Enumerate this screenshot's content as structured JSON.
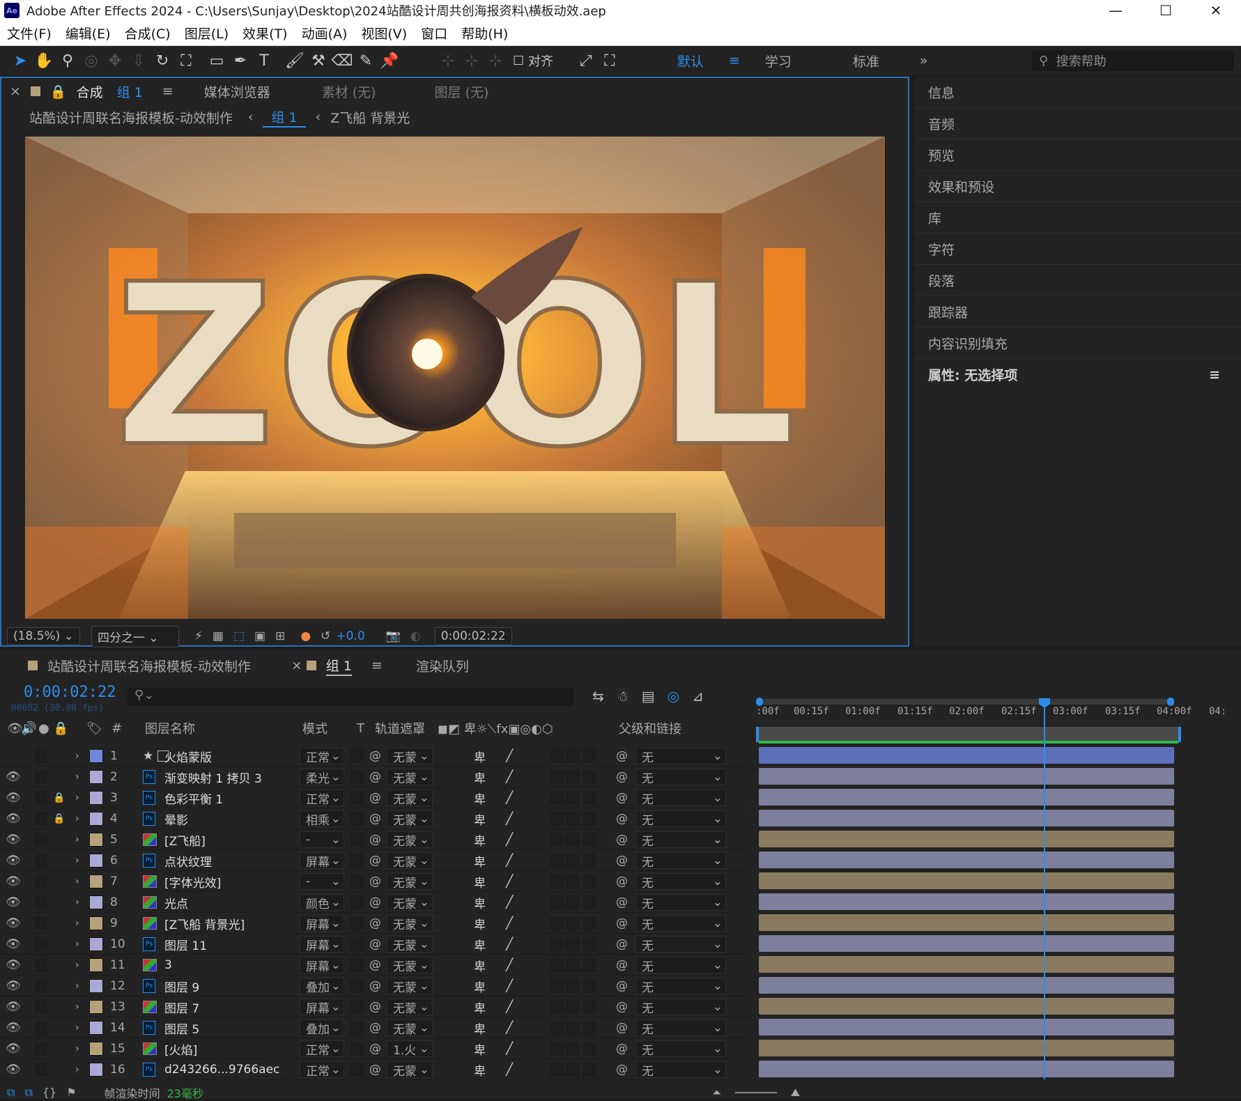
{
  "window": {
    "title": "Adobe After Effects 2024 - C:\\Users\\Sunjay\\Desktop\\2024站酷设计周共创海报资料\\横板动效.aep",
    "logo": "Ae",
    "controls": [
      "—",
      "☐",
      "✕"
    ]
  },
  "menu": [
    "文件(F)",
    "编辑(E)",
    "合成(C)",
    "图层(L)",
    "效果(T)",
    "动画(A)",
    "视图(V)",
    "窗口",
    "帮助(H)"
  ],
  "toolbar": {
    "snap_label": "对齐",
    "workspaces": [
      "默认",
      "学习",
      "标准"
    ],
    "active_workspace": "默认",
    "search_placeholder": "搜索帮助"
  },
  "comp_panel": {
    "tabs": {
      "close": "×",
      "comp_prefix": "合成",
      "comp_name": "组 1",
      "media": "媒体浏览器",
      "footage": "素材  (无)",
      "layer": "图层  (无)"
    },
    "breadcrumbs": [
      "站酷设计周联名海报模板-动效制作",
      "组 1",
      "Z飞船 背景光"
    ],
    "viewer_text": "ZOOL",
    "zoom": "(18.5%)",
    "resolution": "四分之一",
    "exposure": "+0.0",
    "timecode": "0:00:02:22"
  },
  "right_panel": {
    "items": [
      "信息",
      "音频",
      "预览",
      "效果和预设",
      "库",
      "字符",
      "段落",
      "跟踪器",
      "内容识别填充"
    ],
    "properties": "属性: 无选择项"
  },
  "timeline": {
    "tabs": [
      "站酷设计周联名海报模板-动效制作",
      "组 1",
      "渲染队列"
    ],
    "timecode": "0:00:02:22",
    "frame_info": "00082 (30.00 fps)",
    "columns": {
      "num": "#",
      "name": "图层名称",
      "mode": "模式",
      "t": "T",
      "matte": "轨道遮罩",
      "parent": "父级和链接"
    },
    "ruler": [
      ":00f",
      "00:15f",
      "01:00f",
      "01:15f",
      "02:00f",
      "02:15f",
      "03:00f",
      "03:15f",
      "04:00f",
      "04:"
    ],
    "layers": [
      {
        "num": "1",
        "name": "火焰蒙版",
        "mode": "正常",
        "matte": "无蒙",
        "parent": "无",
        "type": "shape",
        "color": "#6f86d9",
        "eye": false,
        "lock": false,
        "bar": "#5d6fb8"
      },
      {
        "num": "2",
        "name": "渐变映射 1 拷贝 3",
        "mode": "柔光",
        "matte": "无蒙",
        "parent": "无",
        "type": "ps",
        "color": "#a9a9d4",
        "eye": true,
        "lock": false,
        "bar": "#7e7e9d"
      },
      {
        "num": "3",
        "name": "色彩平衡 1",
        "mode": "正常",
        "matte": "无蒙",
        "parent": "无",
        "type": "ps",
        "color": "#a9a9d4",
        "eye": true,
        "lock": true,
        "bar": "#7e7e9d"
      },
      {
        "num": "4",
        "name": "晕影",
        "mode": "相乘",
        "matte": "无蒙",
        "parent": "无",
        "type": "ps",
        "color": "#a9a9d4",
        "eye": true,
        "lock": true,
        "bar": "#7e7e9d"
      },
      {
        "num": "5",
        "name": "[Z飞船]",
        "mode": "-",
        "matte": "无蒙",
        "parent": "无",
        "type": "comp",
        "color": "#b5a27c",
        "eye": true,
        "lock": false,
        "bar": "#8a7b60"
      },
      {
        "num": "6",
        "name": "点状纹理",
        "mode": "屏幕",
        "matte": "无蒙",
        "parent": "无",
        "type": "ps",
        "color": "#a9a9d4",
        "eye": true,
        "lock": false,
        "bar": "#7e7e9d"
      },
      {
        "num": "7",
        "name": "[字体光效]",
        "mode": "-",
        "matte": "无蒙",
        "parent": "无",
        "type": "comp",
        "color": "#b5a27c",
        "eye": true,
        "lock": false,
        "bar": "#8a7b60"
      },
      {
        "num": "8",
        "name": "光点",
        "mode": "颜色",
        "matte": "无蒙",
        "parent": "无",
        "type": "comp",
        "color": "#a9a9d4",
        "eye": true,
        "lock": false,
        "bar": "#7e7e9d"
      },
      {
        "num": "9",
        "name": "[Z飞船 背景光]",
        "mode": "屏幕",
        "matte": "无蒙",
        "parent": "无",
        "type": "comp",
        "color": "#b5a27c",
        "eye": true,
        "lock": false,
        "bar": "#8a7b60"
      },
      {
        "num": "10",
        "name": "图层 11",
        "mode": "屏幕",
        "matte": "无蒙",
        "parent": "无",
        "type": "ps",
        "color": "#a9a9d4",
        "eye": true,
        "lock": false,
        "bar": "#7e7e9d"
      },
      {
        "num": "11",
        "name": "3",
        "mode": "屏幕",
        "matte": "无蒙",
        "parent": "无",
        "type": "comp",
        "color": "#b5a27c",
        "eye": true,
        "lock": false,
        "bar": "#8a7b60"
      },
      {
        "num": "12",
        "name": "图层 9",
        "mode": "叠加",
        "matte": "无蒙",
        "parent": "无",
        "type": "ps",
        "color": "#a9a9d4",
        "eye": true,
        "lock": false,
        "bar": "#7e7e9d"
      },
      {
        "num": "13",
        "name": "图层 7",
        "mode": "屏幕",
        "matte": "无蒙",
        "parent": "无",
        "type": "comp",
        "color": "#b5a27c",
        "eye": true,
        "lock": false,
        "bar": "#8a7b60"
      },
      {
        "num": "14",
        "name": "图层 5",
        "mode": "叠加",
        "matte": "无蒙",
        "parent": "无",
        "type": "ps",
        "color": "#a9a9d4",
        "eye": true,
        "lock": false,
        "bar": "#7e7e9d"
      },
      {
        "num": "15",
        "name": "[火焰]",
        "mode": "正常",
        "matte": "1.火",
        "parent": "无",
        "type": "comp",
        "color": "#b5a27c",
        "eye": true,
        "lock": false,
        "bar": "#8a7b60"
      },
      {
        "num": "16",
        "name": "d243266...9766aec",
        "mode": "正常",
        "matte": "无蒙",
        "parent": "无",
        "type": "ps",
        "color": "#a9a9d4",
        "eye": true,
        "lock": false,
        "bar": "#7e7e9d"
      }
    ],
    "status_label": "帧渲染时间",
    "status_value": "23毫秒"
  }
}
